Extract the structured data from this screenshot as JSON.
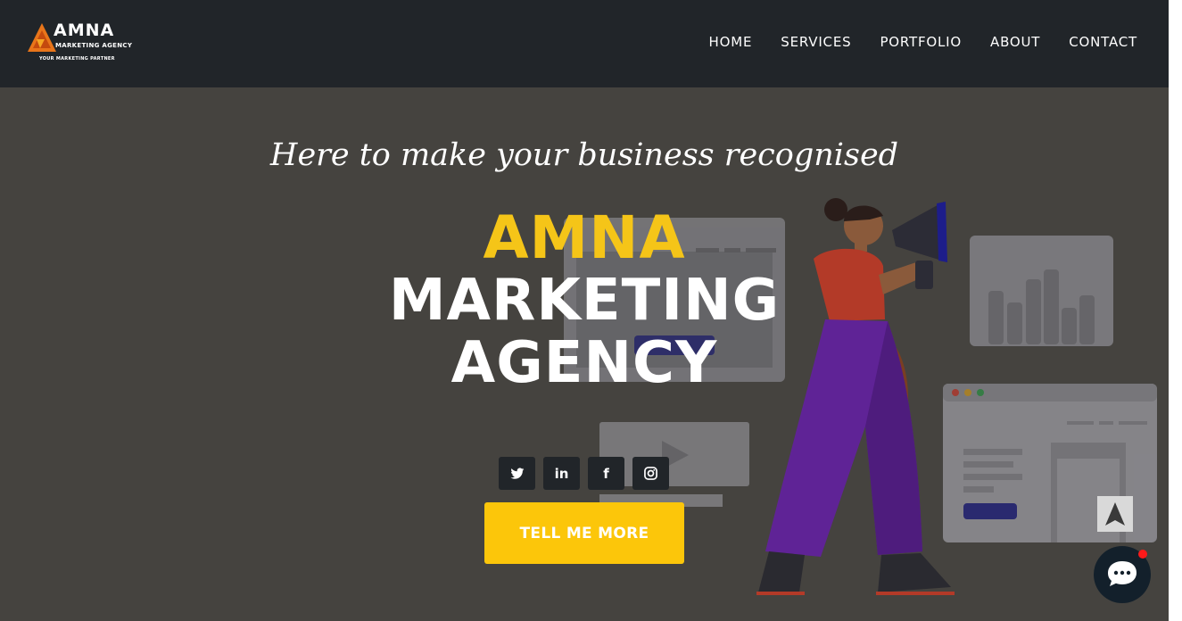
{
  "brand": {
    "name": "AMNA",
    "subtitle": "MARKETING AGENCY",
    "tagline": "YOUR MARKETING PARTNER"
  },
  "nav": {
    "items": [
      "HOME",
      "SERVICES",
      "PORTFOLIO",
      "ABOUT",
      "CONTACT"
    ]
  },
  "hero": {
    "tagline": "Here to make your business recognised",
    "heading_line1": "AMNA",
    "heading_line2": "MARKETING",
    "heading_line3": "AGENCY",
    "cta_label": "TELL ME MORE"
  },
  "social": [
    "twitter-icon",
    "linkedin-icon",
    "facebook-icon",
    "instagram-icon"
  ],
  "floating": {
    "back_to_top": "arrow-up-icon",
    "chat": "chat-bubble-icon"
  },
  "colors": {
    "navbar": "#212529",
    "hero_bg": "#45433f",
    "accent_yellow": "#f5c518",
    "cta": "#fcc60a"
  }
}
